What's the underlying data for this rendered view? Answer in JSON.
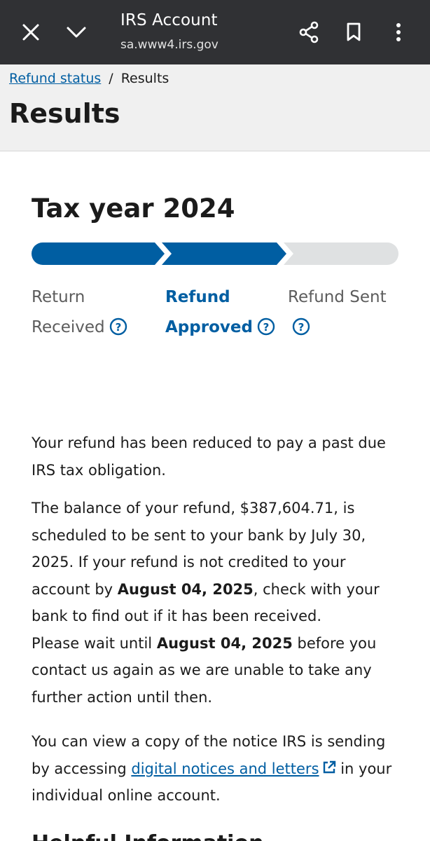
{
  "browser": {
    "title": "IRS Account",
    "url": "sa.www4.irs.gov"
  },
  "breadcrumb": {
    "link": "Refund status",
    "separator": "/",
    "current": "Results"
  },
  "page": {
    "title": "Results",
    "tax_year": "Tax year 2024"
  },
  "progress": {
    "steps": [
      {
        "line1": "Return",
        "line2": "Received",
        "state": "complete"
      },
      {
        "line1": "Refund",
        "line2": "Approved",
        "state": "current"
      },
      {
        "line1": "Refund Sent",
        "line2": "",
        "state": "pending"
      }
    ],
    "colors": {
      "complete": "#005ea2",
      "pending": "#dfe1e2"
    }
  },
  "content": {
    "p1": "Your refund has been reduced to pay a past due IRS tax obligation.",
    "p2_a": "The balance of your refund, $387,604.71, is scheduled to be sent to your bank by July 30, 2025. If your refund is not credited to your account by ",
    "p2_date1": "August 04, 2025",
    "p2_b": ", check with your bank to find out if it has been received.",
    "p2_c": "Please wait until ",
    "p2_date2": "August 04, 2025",
    "p2_d": " before you contact us again as we are unable to take any further action until then.",
    "p3_a": "You can view a copy of the notice IRS is sending by accessing ",
    "p3_link": "digital notices and letters",
    "p3_b": " in your individual online account.",
    "next_heading": "Helpful Information"
  },
  "icons": {
    "close": "close-icon",
    "chevron": "chevron-down-icon",
    "share": "share-icon",
    "bookmark": "bookmark-icon",
    "more": "more-vert-icon",
    "help": "help-circle-icon",
    "external": "external-link-icon"
  }
}
